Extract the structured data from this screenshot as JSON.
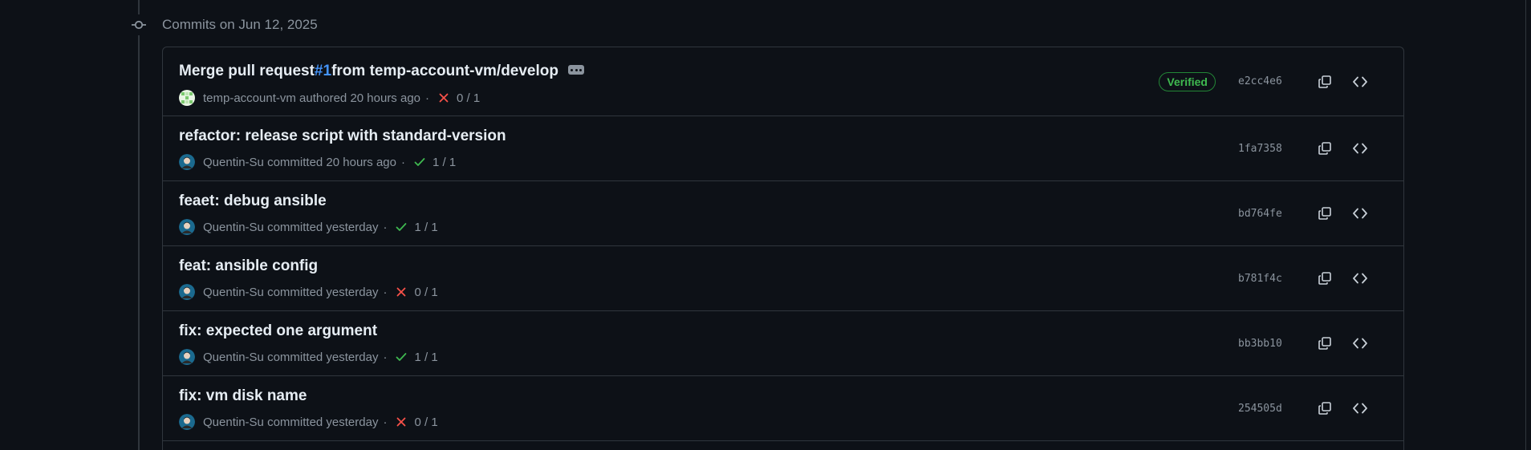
{
  "group": {
    "title": "Commits on Jun 12, 2025"
  },
  "commits": [
    {
      "title_prefix": "Merge pull request ",
      "pr_link": "#1",
      "title_suffix": " from temp-account-vm/develop",
      "has_ellipsis": true,
      "author": "temp-account-vm",
      "action": "authored",
      "time": "20 hours ago",
      "status": "fail",
      "checks": "0 / 1",
      "verified": "Verified",
      "sha": "e2cc4e6",
      "avatar": "identicon"
    },
    {
      "title": "refactor: release script with standard-version",
      "author": "Quentin-Su",
      "action": "committed",
      "time": "20 hours ago",
      "status": "pass",
      "checks": "1 / 1",
      "sha": "1fa7358",
      "avatar": "photo"
    },
    {
      "title": "feaet: debug ansible",
      "author": "Quentin-Su",
      "action": "committed",
      "time": "yesterday",
      "status": "pass",
      "checks": "1 / 1",
      "sha": "bd764fe",
      "avatar": "photo"
    },
    {
      "title": "feat: ansible config",
      "author": "Quentin-Su",
      "action": "committed",
      "time": "yesterday",
      "status": "fail",
      "checks": "0 / 1",
      "sha": "b781f4c",
      "avatar": "photo"
    },
    {
      "title": "fix: expected one argument",
      "author": "Quentin-Su",
      "action": "committed",
      "time": "yesterday",
      "status": "pass",
      "checks": "1 / 1",
      "sha": "bb3bb10",
      "avatar": "photo"
    },
    {
      "title": "fix: vm disk name",
      "author": "Quentin-Su",
      "action": "committed",
      "time": "yesterday",
      "status": "fail",
      "checks": "0 / 1",
      "sha": "254505d",
      "avatar": "photo"
    }
  ],
  "colors": {
    "background": "#0d1117",
    "border": "#30363d",
    "text": "#e6edf3",
    "muted": "#8b949e",
    "link": "#4493f8",
    "success": "#3fb950",
    "danger": "#f85149"
  },
  "icons": {
    "commit": "git-commit-icon",
    "copy": "copy-icon",
    "browse": "code-icon",
    "pass": "check-icon",
    "fail": "x-icon",
    "more": "ellipsis-icon"
  }
}
